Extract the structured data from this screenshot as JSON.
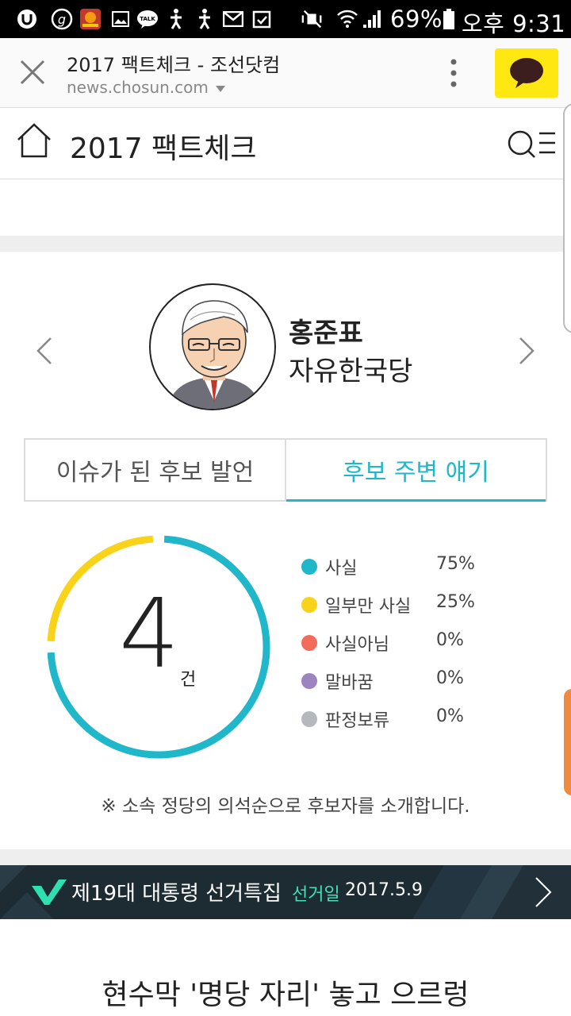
{
  "status_bar": {
    "battery": "69%",
    "time": "오후 9:31",
    "talk_badge": "TALK"
  },
  "browser": {
    "page_title": "2017 팩트체크 - 조선닷컴",
    "url": "news.chosun.com"
  },
  "header": {
    "title": "2017 팩트체크"
  },
  "candidate": {
    "name": "홍준표",
    "party": "자유한국당"
  },
  "tabs": [
    {
      "label": "이슈가 된 후보 발언",
      "active": false
    },
    {
      "label": "후보 주변 얘기",
      "active": true
    }
  ],
  "summary": {
    "count": "4",
    "unit": "건"
  },
  "legend": [
    {
      "label": "사실",
      "pct": "75%",
      "value": 75,
      "color": "#1fb7c9"
    },
    {
      "label": "일부만 사실",
      "pct": "25%",
      "value": 25,
      "color": "#f9d21a"
    },
    {
      "label": "사실아님",
      "pct": "0%",
      "value": 0,
      "color": "#f26b5b"
    },
    {
      "label": "말바꿈",
      "pct": "0%",
      "value": 0,
      "color": "#9b84c0"
    },
    {
      "label": "판정보류",
      "pct": "0%",
      "value": 0,
      "color": "#b5b9bd"
    }
  ],
  "note": "※ 소속 정당의 의석순으로 후보자를 소개합니다.",
  "banner": {
    "title": "제19대 대통령 선거특집",
    "date_label": "선거일",
    "date": "2017.5.9"
  },
  "headline": "현수막 '명당 자리' 놓고 으르렁"
}
